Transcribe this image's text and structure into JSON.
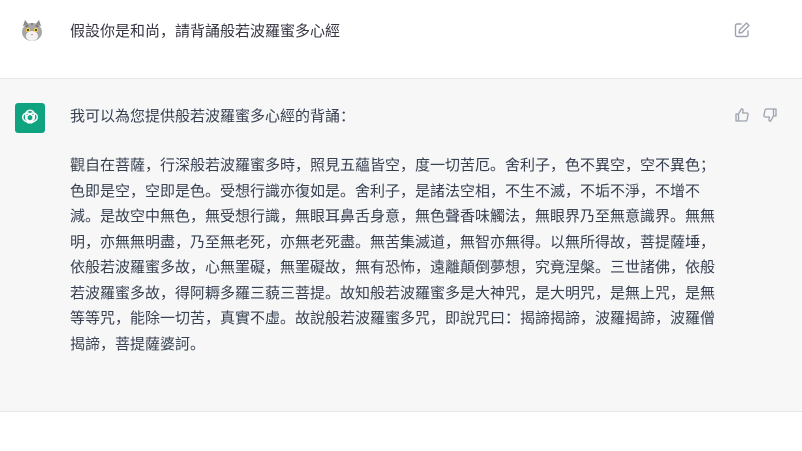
{
  "user_message": {
    "text": "假設你是和尚，請背誦般若波羅蜜多心經",
    "avatar_icon": "cat-avatar-icon",
    "edit_icon": "pencil-square-icon"
  },
  "assistant_message": {
    "avatar_icon": "openai-logo-icon",
    "avatar_color": "#10a37f",
    "intro": "我可以為您提供般若波羅蜜多心經的背誦：",
    "body": "觀自在菩薩，行深般若波羅蜜多時，照見五蘊皆空，度一切苦厄。舍利子，色不異空，空不異色；色即是空，空即是色。受想行識亦復如是。舍利子，是諸法空相，不生不滅，不垢不淨，不增不減。是故空中無色，無受想行識，無眼耳鼻舌身意，無色聲香味觸法，無眼界乃至無意識界。無無明，亦無無明盡，乃至無老死，亦無老死盡。無苦集滅道，無智亦無得。以無所得故，菩提薩埵，依般若波羅蜜多故，心無罣礙，無罣礙故，無有恐怖，遠離顛倒夢想，究竟涅槃。三世諸佛，依般若波羅蜜多故，得阿耨多羅三藐三菩提。故知般若波羅蜜多是大神咒，是大明咒，是無上咒，是無等等咒，能除一切苦，真實不虛。故說般若波羅蜜多咒，即說咒曰：揭諦揭諦，波羅揭諦，波羅僧揭諦，菩提薩婆訶。",
    "thumb_up_icon": "thumbs-up-icon",
    "thumb_down_icon": "thumbs-down-icon"
  }
}
